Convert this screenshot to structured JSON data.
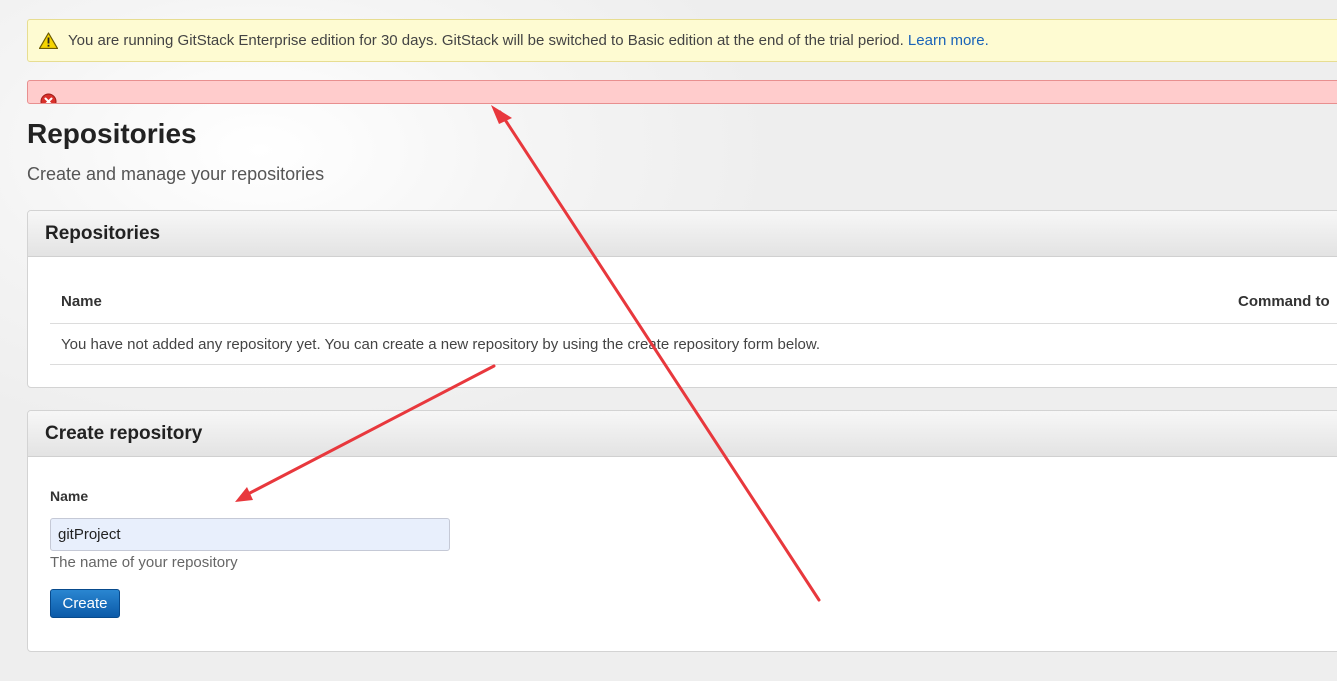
{
  "notice": {
    "message": "You are running GitStack Enterprise edition for 30 days. GitStack will be switched to Basic edition at the end of the trial period.",
    "link_label": "Learn more."
  },
  "page": {
    "title": "Repositories",
    "subtitle": "Create and manage your repositories"
  },
  "repositories_panel": {
    "title": "Repositories",
    "columns": [
      "Name",
      "Command to"
    ],
    "empty_message": "You have not added any repository yet. You can create a new repository by using the create repository form below."
  },
  "create_panel": {
    "title": "Create repository",
    "name_label": "Name",
    "name_value": "gitProject",
    "name_help": "The name of your repository",
    "create_label": "Create"
  },
  "colors": {
    "notice_background": "#fefbd2",
    "error_background": "#ffcccc",
    "link": "#1a63b8",
    "button": "#0b5aa8",
    "annotation_arrow": "#e8383d"
  }
}
